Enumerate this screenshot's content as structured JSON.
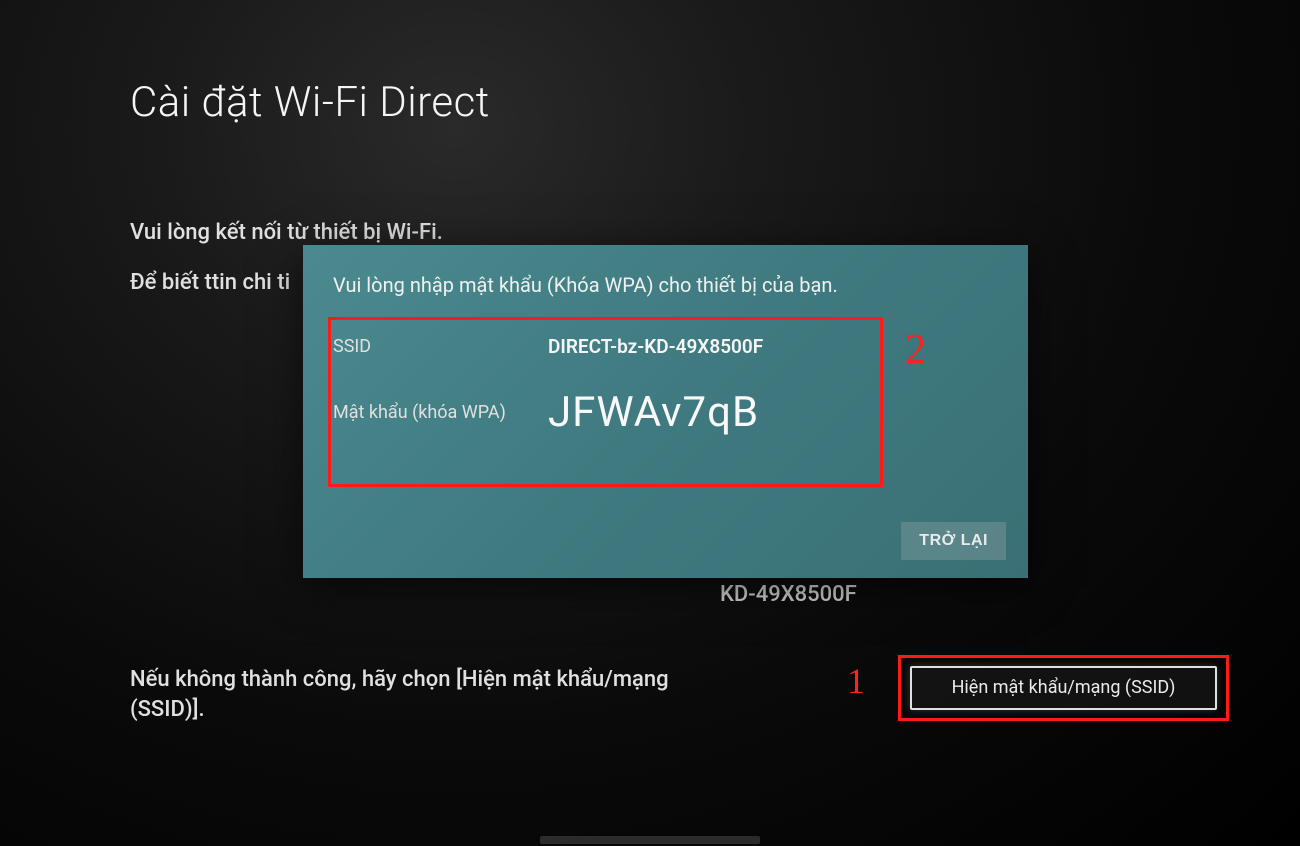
{
  "page": {
    "title": "Cài đặt Wi-Fi Direct",
    "line1": "Vui lòng kết nối từ thiết bị Wi-Fi.",
    "line2": "Để biết ttin chi ti",
    "device_name": "KD-49X8500F",
    "bottom_text": "Nếu không thành công, hãy chọn [Hiện mật khẩu/mạng (SSID)].",
    "show_button_label": "Hiện mật khẩu/mạng (SSID)"
  },
  "dialog": {
    "title": "Vui lòng nhập mật khẩu (Khóa WPA) cho thiết bị của bạn.",
    "ssid_label": "SSID",
    "ssid_value": "DIRECT-bz-KD-49X8500F",
    "password_label": "Mật khẩu (khóa WPA)",
    "password_value": "JFWAv7qB",
    "back_button_label": "TRỞ LẠI"
  },
  "annotations": {
    "marker1": "1",
    "marker2": "2"
  }
}
